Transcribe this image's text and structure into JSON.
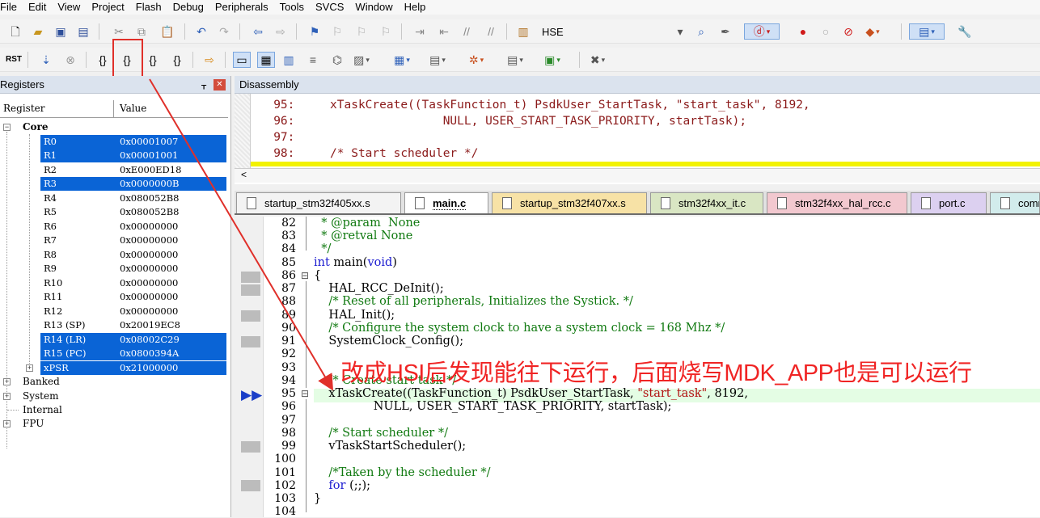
{
  "menu": [
    "File",
    "Edit",
    "View",
    "Project",
    "Flash",
    "Debug",
    "Peripherals",
    "Tools",
    "SVCS",
    "Window",
    "Help"
  ],
  "toolbar1": {
    "target_label": "HSE"
  },
  "registers": {
    "title": "Registers",
    "col_register": "Register",
    "col_value": "Value",
    "core_label": "Core",
    "rows": [
      {
        "name": "R0",
        "value": "0x00001007"
      },
      {
        "name": "R1",
        "value": "0x00001001"
      },
      {
        "name": "R2",
        "value": "0xE000ED18"
      },
      {
        "name": "R3",
        "value": "0x0000000B"
      },
      {
        "name": "R4",
        "value": "0x080052B8"
      },
      {
        "name": "R5",
        "value": "0x080052B8"
      },
      {
        "name": "R6",
        "value": "0x00000000"
      },
      {
        "name": "R7",
        "value": "0x00000000"
      },
      {
        "name": "R8",
        "value": "0x00000000"
      },
      {
        "name": "R9",
        "value": "0x00000000"
      },
      {
        "name": "R10",
        "value": "0x00000000"
      },
      {
        "name": "R11",
        "value": "0x00000000"
      },
      {
        "name": "R12",
        "value": "0x00000000"
      },
      {
        "name": "R13 (SP)",
        "value": "0x20019EC8"
      },
      {
        "name": "R14 (LR)",
        "value": "0x08002C29"
      },
      {
        "name": "R15 (PC)",
        "value": "0x0800394A"
      },
      {
        "name": "xPSR",
        "value": "0x21000000"
      }
    ],
    "groups": [
      "Banked",
      "System",
      "Internal",
      "FPU"
    ]
  },
  "disassembly": {
    "title": "Disassembly",
    "lines": [
      "   95:     xTaskCreate((TaskFunction_t) PsdkUser_StartTask, \"start_task\", 8192,",
      "   96:                     NULL, USER_START_TASK_PRIORITY, startTask);",
      "   97:",
      "   98:     /* Start scheduler */"
    ]
  },
  "tabs": [
    "startup_stm32f405xx.s",
    "main.c",
    "startup_stm32f407xx.s",
    "stm32f4xx_it.c",
    "stm32f4xx_hal_rcc.c",
    "port.c",
    "comm"
  ],
  "editor": {
    "line_numbers": [
      "82",
      "83",
      "84",
      "85",
      "86",
      "87",
      "88",
      "89",
      "90",
      "91",
      "92",
      "93",
      "94",
      "95",
      "96",
      "97",
      "98",
      "99",
      "100",
      "101",
      "102",
      "103",
      "104"
    ],
    "code": {
      "l82": "  * @param  None",
      "l83": "  * @retval None",
      "l84": "  */",
      "l85a": "int",
      "l85b": " main(",
      "l85c": "void",
      "l85d": ")",
      "l86": "{",
      "l87": "    HAL_RCC_DeInit();",
      "l88": "    /* Reset of all peripherals, Initializes the Systick. */",
      "l89": "    HAL_Init();",
      "l90": "    /* Configure the system clock to have a system clock = 168 Mhz */",
      "l91": "    SystemClock_Config();",
      "l94": "    /* Create start task */",
      "l95a": "    xTaskCreate((TaskFunction_t) PsdkUser_StartTask, ",
      "l95b": "\"start_task\"",
      "l95c": ", 8192,",
      "l96": "                NULL, USER_START_TASK_PRIORITY, startTask);",
      "l98": "    /* Start scheduler */",
      "l99": "    vTaskStartScheduler();",
      "l101": "    /*Taken by the scheduler */",
      "l102a": "    for",
      "l102b": " (;;);",
      "l103": "}"
    },
    "annotation": "改成HSI后发现能往下运行，后面烧写MDK_APP也是可以运行"
  },
  "colors": {
    "selection": "#0a64d6",
    "annotation": "#f02424",
    "current_line": "#e4fde4"
  }
}
